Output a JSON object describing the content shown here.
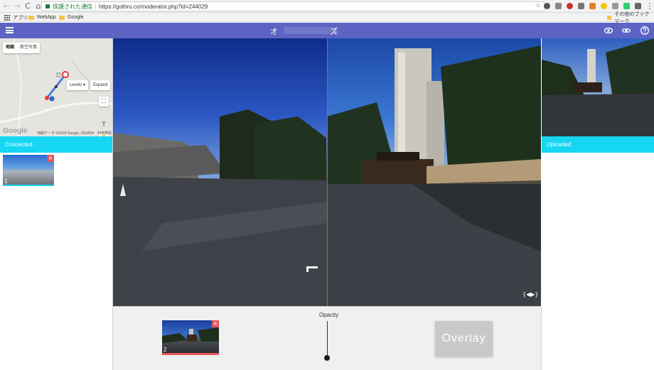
{
  "browser": {
    "nav": {
      "back": "←",
      "forward": "→",
      "reload": "C",
      "home": "⌂"
    },
    "secure_label": "保護された通信",
    "url": "https://gothru.co/moderator.php?id=244029",
    "star": "☆",
    "bookmarks": [
      {
        "label": "アプリ",
        "icon": "apps-icon"
      },
      {
        "label": "WebApp",
        "icon": "folder-icon"
      },
      {
        "label": "Google",
        "icon": "folder-icon"
      }
    ],
    "other_bookmarks": "その他のブックマーク",
    "menu": "⋮"
  },
  "header": {
    "title": "オ　　　　　　ズ",
    "accent": "#5c63c2",
    "icons": [
      "eye-icon",
      "link-icon",
      "help-icon"
    ]
  },
  "map": {
    "type_buttons": [
      "地図",
      "航空写真"
    ],
    "levels_label": "Levels",
    "expand_label": "Expand",
    "fullscreen": "⛶",
    "text_tool": "T",
    "zoom_in": "+",
    "zoom_out": "−",
    "google": "Google",
    "attribution": "地図データ ©2018 Google, ZENRIN　利用規約",
    "marker_label": "1"
  },
  "panels": {
    "connected_label": "Connected",
    "uploaded_label": "Uploaded",
    "bar_color": "#16d6f2"
  },
  "thumbnails": [
    {
      "num": "1",
      "close": "×"
    },
    {
      "num": "2",
      "close": "×"
    }
  ],
  "viewer": {
    "compass": "{◀▶}"
  },
  "controls": {
    "opacity_label": "Opacity",
    "overlay_label": "Overlay"
  }
}
